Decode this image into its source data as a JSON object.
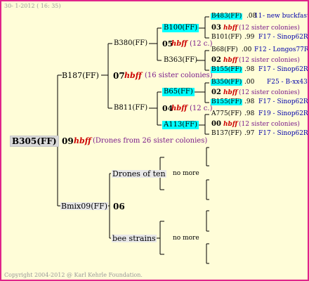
{
  "header": {
    "date": "30- 1-2012 ( 16: 35)"
  },
  "footer": {
    "copyright": "Copyright 2004-2012 @ Karl Kehrle Foundation."
  },
  "root": {
    "label": "B305(FF)",
    "mark": "09",
    "hbff": "hbff",
    "desc": "(Drones from 26 sister colonies)"
  },
  "b187": {
    "label": "B187(FF)",
    "mark": "07",
    "hbff": "hbff",
    "desc": "(16 sister colonies)"
  },
  "b380": {
    "label": "B380(FF)",
    "mark": "05",
    "hbff": "hbff",
    "desc": "(12 c.)"
  },
  "b811": {
    "label": "B811(FF)",
    "mark": "04",
    "hbff": "hbff",
    "desc": "(12 c.)"
  },
  "b100": {
    "label": "B100(FF)"
  },
  "b363": {
    "label": "B363(FF)"
  },
  "b65": {
    "label": "B65(FF)"
  },
  "a113": {
    "label": "A113(FF)"
  },
  "bmix": {
    "label": "Bmix09(FF)",
    "mark": "06"
  },
  "drones": {
    "label": "Drones of ten",
    "more": "no more"
  },
  "bee": {
    "label": "bee strains",
    "more": "no more"
  },
  "right": {
    "r1": {
      "id": "B483(FF)",
      "yr": ".08",
      "pre": "11",
      "breeder": "- new buckfast"
    },
    "r2": {
      "mark": "03",
      "hbff": "hbff",
      "desc": "(12 sister colonies)"
    },
    "r3": {
      "id": "B101(FF)",
      "yr": ".99",
      "breeder": "F17 - Sinop62R"
    },
    "r4": {
      "id": "B68(FF)",
      "yr": ".00",
      "breeder": "F12 - Longos77R"
    },
    "r5": {
      "mark": "02",
      "hbff": "hbff",
      "desc": "(12 sister colonies)"
    },
    "r6": {
      "id": "B155(FF)",
      "yr": ".98",
      "breeder": "F17 - Sinop62R"
    },
    "r7": {
      "id": "B350(FF)",
      "yr": ".00",
      "breeder": "F25 - B-xx43"
    },
    "r8": {
      "mark": "02",
      "hbff": "hbff",
      "desc": "(12 sister colonies)"
    },
    "r9": {
      "id": "B155(FF)",
      "yr": ".98",
      "breeder": "F17 - Sinop62R"
    },
    "r10": {
      "id": "A775(FF)",
      "yr": ".98",
      "breeder": "F19 - Sinop62R"
    },
    "r11": {
      "mark": "00",
      "hbff": "hbff",
      "desc": "(12 sister colonies)"
    },
    "r12": {
      "id": "B137(FF)",
      "yr": ".97",
      "breeder": "F17 - Sinop62R"
    }
  },
  "colors": {
    "border": "#e0248a",
    "background": "#fffdd8",
    "highlight": "#00ffff",
    "hbff": "#cc0000",
    "breeder": "#0000aa"
  }
}
